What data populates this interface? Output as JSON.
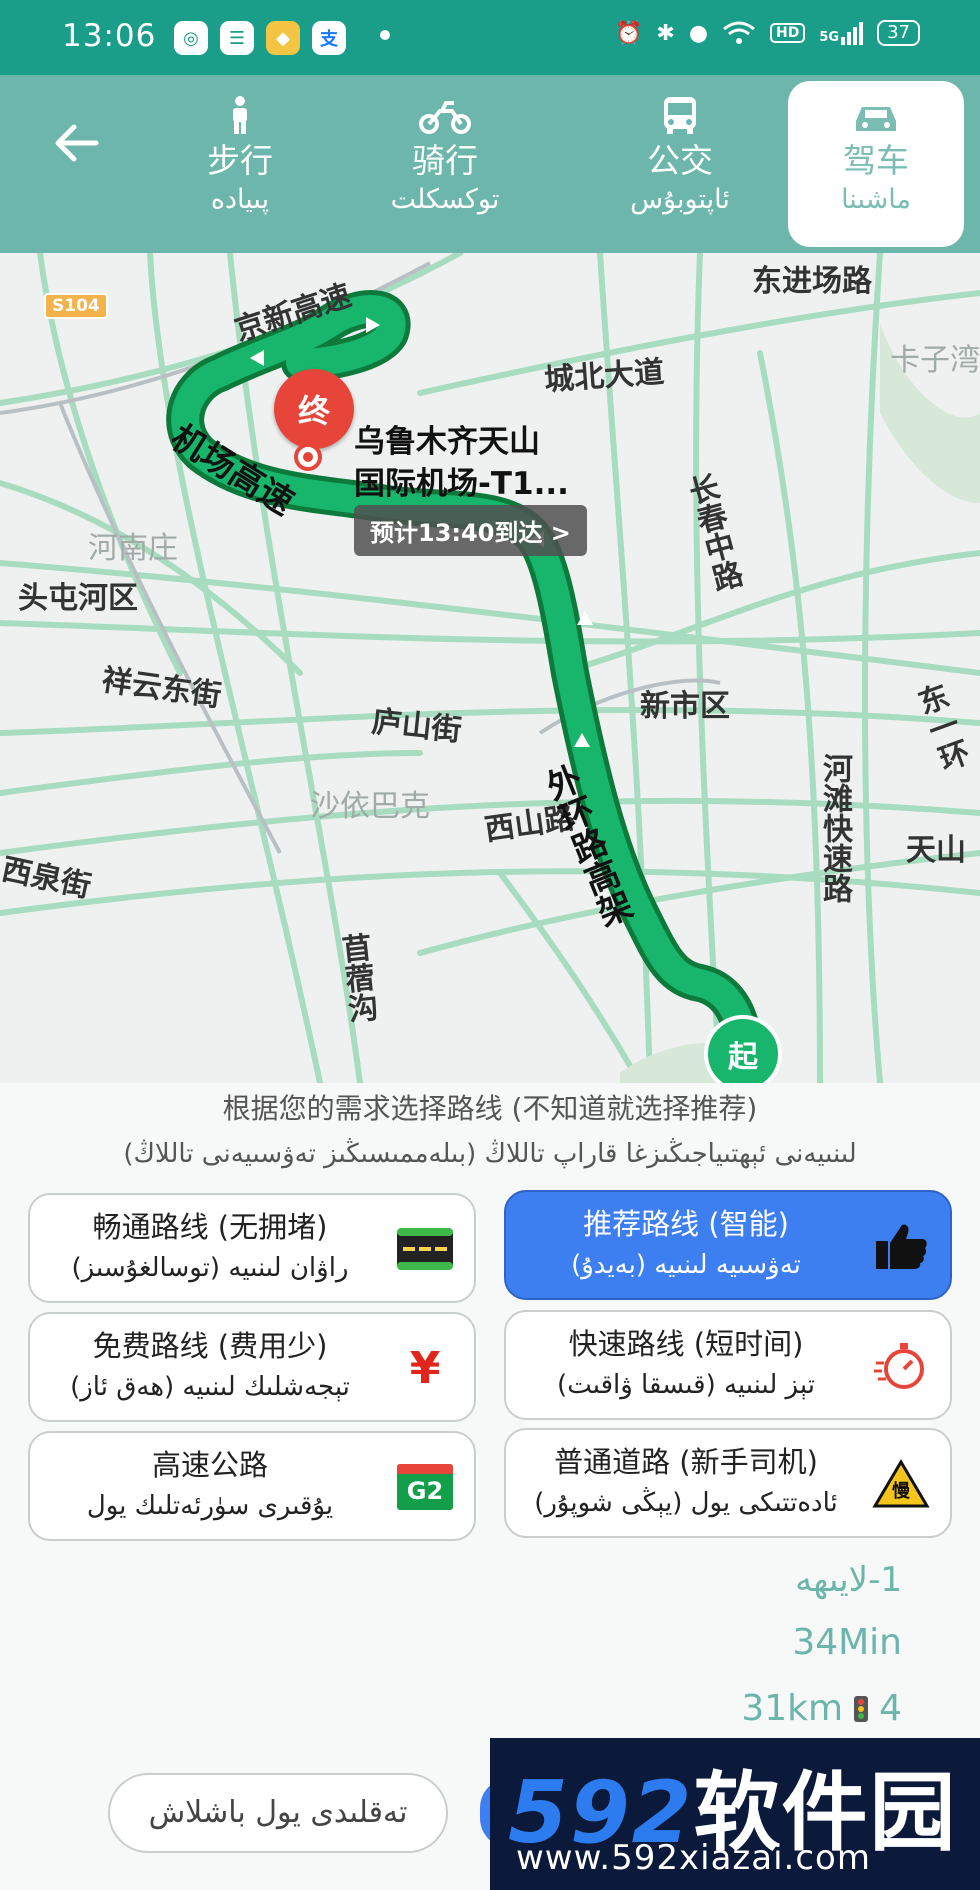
{
  "status_bar": {
    "time": "13:06",
    "network": "5G",
    "hd": "HD",
    "battery": "37"
  },
  "modes": [
    {
      "zh": "步行",
      "ug": "پىيادە",
      "icon": "walk-icon"
    },
    {
      "zh": "骑行",
      "ug": "توكسكلت",
      "icon": "motorcycle-icon"
    },
    {
      "zh": "公交",
      "ug": "ئاپتوبۇس",
      "icon": "bus-icon"
    },
    {
      "zh": "驾车",
      "ug": "ماشىنا",
      "icon": "car-icon",
      "active": true
    }
  ],
  "map": {
    "shield": "S104",
    "labels": {
      "jingxin": "京新高速",
      "dongjin": "东进场路",
      "chengbei": "城北大道",
      "kazi": "卡子湾",
      "changchun": "长春中路",
      "henan": "河南庄",
      "toutunhe": "头屯河区",
      "xiangyun": "祥云东街",
      "lushan": "庐山街",
      "xinshi": "新市区",
      "dongyi": "东一环",
      "hetan": "河滩快速路",
      "shayibake": "沙依巴克",
      "xishan": "西山路",
      "tianshan": "天山",
      "xiquan": "西泉街",
      "muxugou": "苜蓿沟",
      "airport_hwy": "机场高速",
      "outer_ring": "外环路高架"
    },
    "end_marker": "终",
    "start_marker": "起",
    "destination_line1": "乌鲁木齐天山",
    "destination_line2": "国际机场-T1...",
    "eta": "预计13:40到达 >"
  },
  "instruction": {
    "zh": "根据您的需求选择路线 (不知道就选择推荐)",
    "ug": "لىنىيەنى ئېھتىياجىڭىزغا قاراپ تاللاڭ (بىلەممىسىڭىز تەۋسىيەنى تاللاڭ)"
  },
  "options": [
    {
      "zh": "畅通路线 (无拥堵)",
      "ug": "راۋان لىنىيە (توسالغۇسىز)",
      "icon": "clear-road-icon"
    },
    {
      "zh": "推荐路线 (智能)",
      "ug": "تەۋسىيە لىنىيە (بەيدۇ)",
      "icon": "thumbs-up-icon",
      "active": true
    },
    {
      "zh": "免费路线 (费用少)",
      "ug": "تېجەشلىك لىنىيە (ھەق ئاز)",
      "icon": "yuan-icon"
    },
    {
      "zh": "快速路线 (短时间)",
      "ug": "تېز لىنىيە (قىسقا ۋاقىت)",
      "icon": "stopwatch-icon"
    },
    {
      "zh": "高速公路",
      "ug": "يۇقىرى سۈرئەتلىك يول",
      "icon": "g2-highway-icon",
      "badge": "G2"
    },
    {
      "zh": "普通道路 (新手司机)",
      "ug": "ئادەتتىكى يول (يېڭى شوپۇر)",
      "icon": "slow-sign-icon",
      "badge": "慢"
    }
  ],
  "result": {
    "plan": "1-لايىھە",
    "time": "34Min",
    "distance": "31km",
    "lights": "4"
  },
  "nav_button": "تەقلىدى يول باشلاش",
  "watermark": {
    "brand_num": "592",
    "brand_txt": "软件园",
    "url": "www.592xiazai.com"
  },
  "colors": {
    "status_bar": "#1a9e8a",
    "mode_bar": "#6db6ab",
    "route_green": "#18b56c",
    "active_option": "#3d7ef0",
    "end_marker": "#e8453a"
  }
}
